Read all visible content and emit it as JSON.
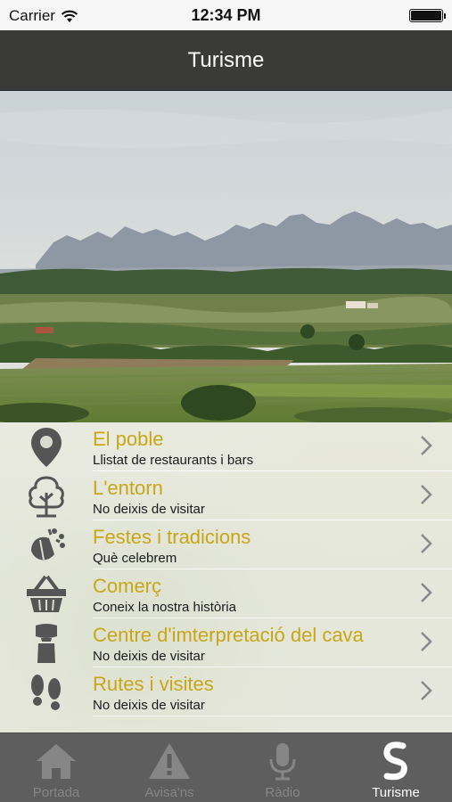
{
  "status_bar": {
    "carrier": "Carrier",
    "time": "12:34 PM"
  },
  "nav": {
    "title": "Turisme"
  },
  "colors": {
    "accent": "#c9a616",
    "nav_background": "#3a3a38",
    "tab_background": "#5e5e5e",
    "tab_inactive": "#868686",
    "tab_active": "#ffffff"
  },
  "menu": {
    "items": [
      {
        "title": "El poble",
        "subtitle": "Llistat de restaurants i bars",
        "icon": "map-pin-icon"
      },
      {
        "title": "L'entorn",
        "subtitle": "No deixis de visitar",
        "icon": "tree-icon"
      },
      {
        "title": "Festes i tradicions",
        "subtitle": "Què celebrem",
        "icon": "celebration-icon"
      },
      {
        "title": "Comerç",
        "subtitle": "Coneix la nostra història",
        "icon": "shopping-basket-icon"
      },
      {
        "title": "Centre d'imterpretació del cava",
        "subtitle": "No deixis de visitar",
        "icon": "cava-cork-icon"
      },
      {
        "title": "Rutes i visites",
        "subtitle": "No deixis de visitar",
        "icon": "footprints-icon"
      }
    ]
  },
  "tab_bar": {
    "tabs": [
      {
        "label": "Portada",
        "icon": "home-icon",
        "active": false
      },
      {
        "label": "Avisa'ns",
        "icon": "warning-icon",
        "active": false
      },
      {
        "label": "Ràdio",
        "icon": "microphone-icon",
        "active": false
      },
      {
        "label": "Turisme",
        "icon": "turisme-logo-icon",
        "active": true
      }
    ]
  }
}
